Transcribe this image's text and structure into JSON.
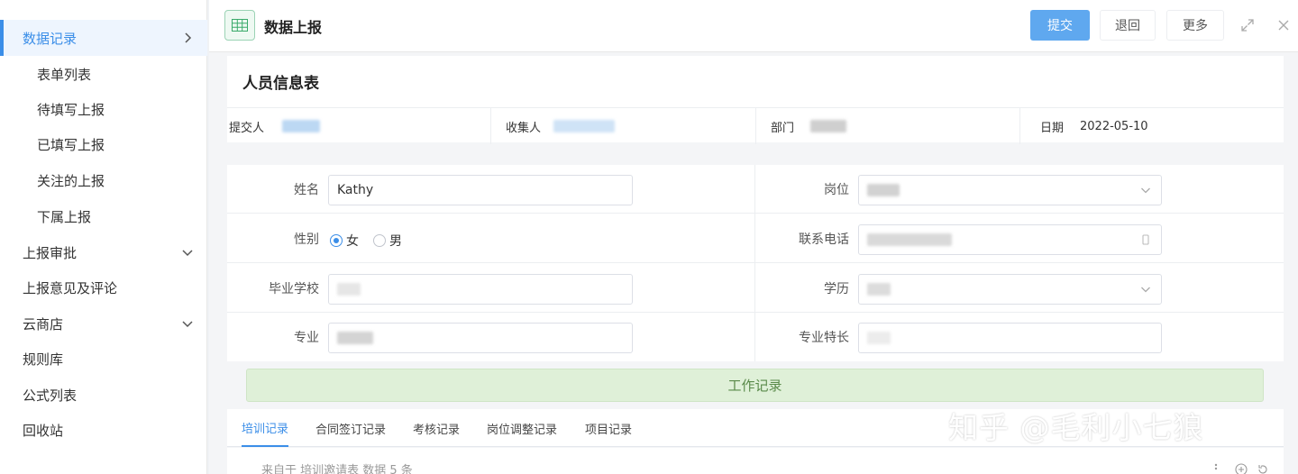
{
  "sidebar": {
    "items": [
      {
        "label": "数据记录"
      },
      {
        "label": "表单列表"
      },
      {
        "label": "待填写上报"
      },
      {
        "label": "已填写上报"
      },
      {
        "label": "关注的上报"
      },
      {
        "label": "下属上报"
      },
      {
        "label": "上报审批"
      },
      {
        "label": "上报意见及评论"
      },
      {
        "label": "云商店"
      },
      {
        "label": "规则库"
      },
      {
        "label": "公式列表"
      },
      {
        "label": "回收站"
      }
    ]
  },
  "header": {
    "title": "数据上报",
    "submit_label": "提交",
    "back_label": "退回",
    "more_label": "更多"
  },
  "card": {
    "title": "人员信息表",
    "meta": {
      "submitter_label": "提交人",
      "collector_label": "收集人",
      "department_label": "部门",
      "date_label": "日期",
      "date_value": "2022-05-10"
    }
  },
  "form": {
    "name_label": "姓名",
    "name_value": "Kathy",
    "position_label": "岗位",
    "gender_label": "性别",
    "gender_female": "女",
    "gender_male": "男",
    "phone_label": "联系电话",
    "school_label": "毕业学校",
    "education_label": "学历",
    "major_label": "专业",
    "specialty_label": "专业特长"
  },
  "work": {
    "bar_label": "工作记录",
    "tabs": [
      {
        "label": "培训记录"
      },
      {
        "label": "合同签订记录"
      },
      {
        "label": "考核记录"
      },
      {
        "label": "岗位调整记录"
      },
      {
        "label": "项目记录"
      }
    ],
    "footer_text": "来自于 培训邀请表 数据 5 条"
  },
  "watermark": "知乎 @毛利小七狼",
  "colors": {
    "accent": "#3b8ee8",
    "primary_button": "#5fa8ef",
    "work_bar": "#dff0d8"
  }
}
